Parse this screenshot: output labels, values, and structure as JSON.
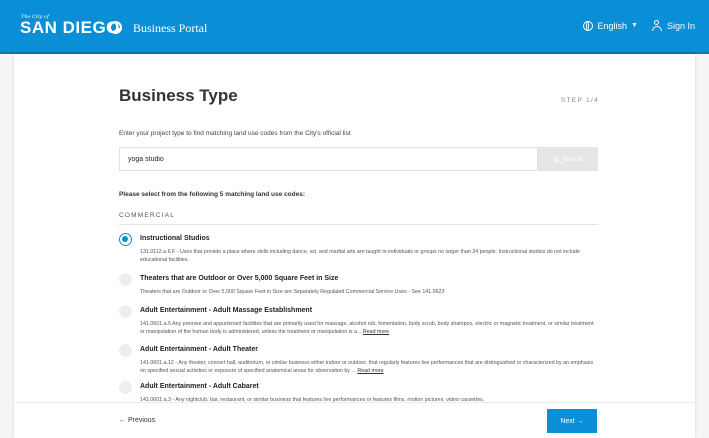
{
  "header": {
    "logo_small": "The City of",
    "logo_main": "SAN DIEGO",
    "portal_title": "Business Portal",
    "language": "English",
    "sign_in": "Sign In"
  },
  "page": {
    "title": "Business Type",
    "step": "STEP 1/4",
    "instructions": "Enter your project type to find matching land use codes from the City's official list"
  },
  "search": {
    "value": "yoga studio",
    "button_label": "Search"
  },
  "results": {
    "prompt": "Please select from the following 5 matching land use codes:",
    "section": "COMMERCIAL",
    "options": [
      {
        "title": "Instructional Studios",
        "desc": "131.0112.a.6.F - Uses that provide a place where skills including dance, art, and martial arts are taught to individuals or groups no larger than 24 people. Instructional studios do not include educational facilities.",
        "selected": true
      },
      {
        "title": "Theaters that are Outdoor or Over 5,000 Square Feet in Size",
        "desc": "Theaters that are Outdoor or Over 5,000 Square Feet in Size are Separately Regulated Commercial Service Uses - See 141.0623",
        "selected": false
      },
      {
        "title": "Adult Entertainment - Adult Massage Establishment",
        "desc": "141.0601.a.5 Any premise and appurtenant facilities that are primarily used for massage, alcohol rub, fomentation, body scrub, body shampoo, electric or magnetic treatment, or similar treatment or manipulation of the human body is administered, unless the treatment or manipulation is a...",
        "read_more": "Read more",
        "selected": false
      },
      {
        "title": "Adult Entertainment - Adult Theater",
        "desc": "141.0601.a.12 - Any theater, concert hall, auditorium, or similar business either indoor or outdoor, that regularly features live performances that are distinguished or characterized by an emphasis on specified sexual activities or exposure of specified anatomical areas for observation by ...",
        "read_more": "Read more",
        "selected": false
      },
      {
        "title": "Adult Entertainment - Adult Cabaret",
        "desc": "141.0601.a.3 - Any nightclub, bar, restaurant, or similar business that features live performances or features films, motion pictures, video cassettes,",
        "selected": false
      }
    ]
  },
  "footer": {
    "previous": "← Previous",
    "next": "Next →"
  },
  "colors": {
    "brand": "#0a8fd6",
    "background": "#f4f5f6"
  }
}
